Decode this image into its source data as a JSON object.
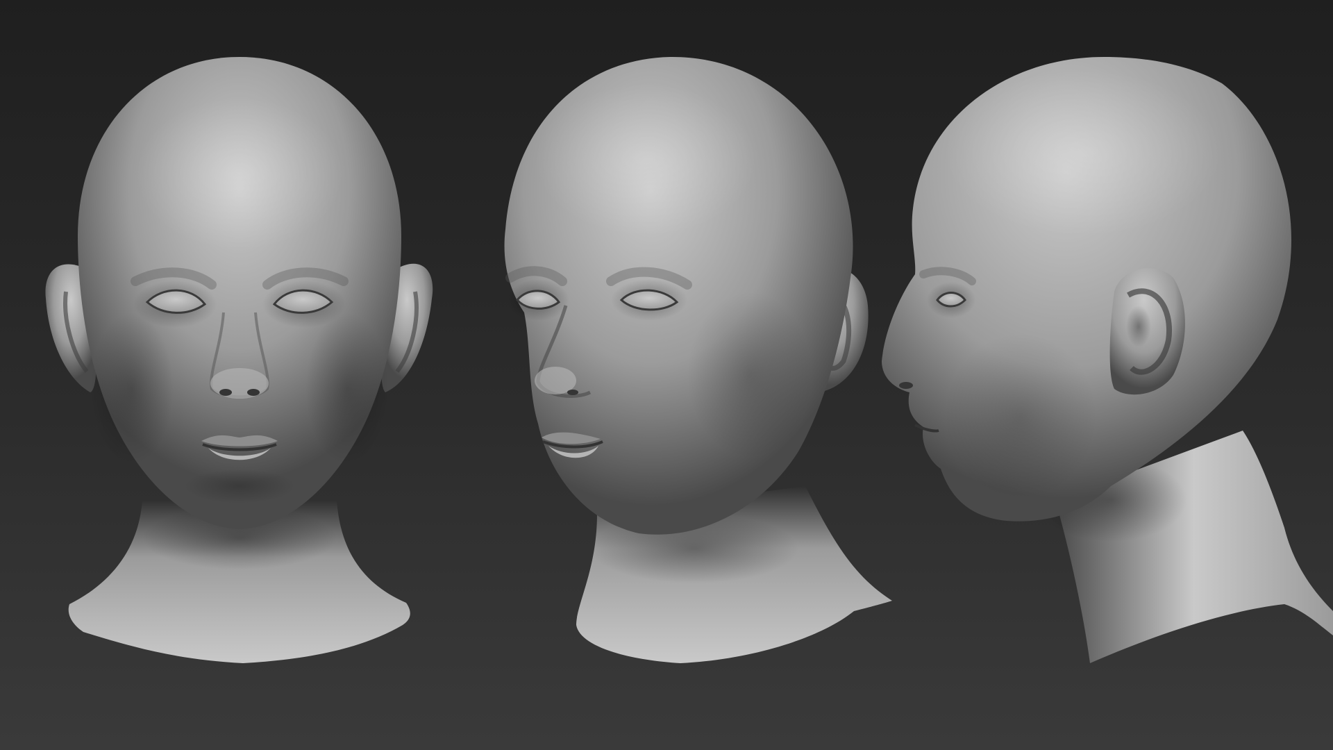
{
  "scene": {
    "views": [
      {
        "name": "front",
        "yaw_degrees": 0
      },
      {
        "name": "three-quarter",
        "yaw_degrees": 35
      },
      {
        "name": "profile",
        "yaw_degrees": 90
      }
    ],
    "colors": {
      "background_top": "#1f1f1f",
      "background_mid": "#2c2c2c",
      "background_bottom": "#3a3a3a",
      "clay_highlight": "#c9c9c9",
      "clay_mid": "#9b9b9b",
      "clay_shadow": "#4a4a4a",
      "clay_deep_shadow": "#2f2f2f"
    }
  }
}
